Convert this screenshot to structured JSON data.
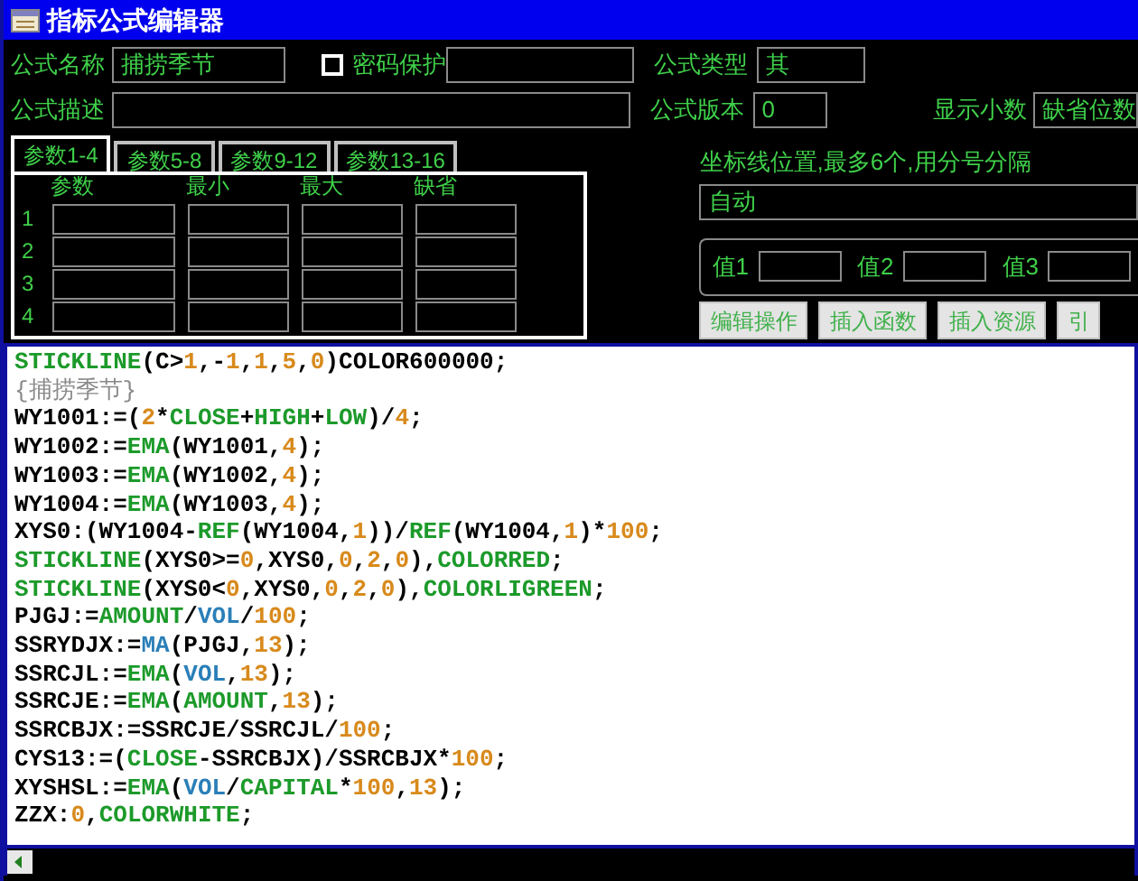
{
  "window": {
    "title": "指标公式编辑器"
  },
  "form": {
    "name_label": "公式名称",
    "name_value": "捕捞季节",
    "password": {
      "label": "密码保护",
      "checked": false
    },
    "type_label": "公式类型",
    "type_value": "其",
    "desc_label": "公式描述",
    "version_label": "公式版本",
    "version_value": "0",
    "decimals_label": "显示小数",
    "decimals_value": "缺省位数"
  },
  "tabs": [
    {
      "label": "参数1-4",
      "selected": true
    },
    {
      "label": "参数5-8",
      "selected": false
    },
    {
      "label": "参数9-12",
      "selected": false
    },
    {
      "label": "参数13-16",
      "selected": false
    }
  ],
  "params": {
    "columns": [
      "参数",
      "最小",
      "最大",
      "缺省"
    ],
    "rows": [
      "1",
      "2",
      "3",
      "4"
    ]
  },
  "axis": {
    "label": "坐标线位置,最多6个,用分号分隔",
    "value": "自动"
  },
  "values": [
    "值1",
    "值2",
    "值3"
  ],
  "buttons": [
    "编辑操作",
    "插入函数",
    "插入资源",
    "引"
  ],
  "code": [
    [
      {
        "kind": "kw",
        "text": "STICKLINE"
      },
      {
        "kind": "plain",
        "text": "(C>"
      },
      {
        "kind": "num",
        "text": "1"
      },
      {
        "kind": "plain",
        "text": ",-"
      },
      {
        "kind": "num",
        "text": "1"
      },
      {
        "kind": "plain",
        "text": ","
      },
      {
        "kind": "num",
        "text": "1"
      },
      {
        "kind": "plain",
        "text": ","
      },
      {
        "kind": "num",
        "text": "5"
      },
      {
        "kind": "plain",
        "text": ","
      },
      {
        "kind": "num",
        "text": "0"
      },
      {
        "kind": "plain",
        "text": ")COLOR600000;"
      }
    ],
    [
      {
        "kind": "comment",
        "text": "{捕捞季节}"
      }
    ],
    [
      {
        "kind": "plain",
        "text": "WY1001:=("
      },
      {
        "kind": "num",
        "text": "2"
      },
      {
        "kind": "plain",
        "text": "*"
      },
      {
        "kind": "kw",
        "text": "CLOSE"
      },
      {
        "kind": "plain",
        "text": "+"
      },
      {
        "kind": "kw",
        "text": "HIGH"
      },
      {
        "kind": "plain",
        "text": "+"
      },
      {
        "kind": "kw",
        "text": "LOW"
      },
      {
        "kind": "plain",
        "text": ")/"
      },
      {
        "kind": "num",
        "text": "4"
      },
      {
        "kind": "plain",
        "text": ";"
      }
    ],
    [
      {
        "kind": "plain",
        "text": "WY1002:="
      },
      {
        "kind": "kw",
        "text": "EMA"
      },
      {
        "kind": "plain",
        "text": "(WY1001,"
      },
      {
        "kind": "num",
        "text": "4"
      },
      {
        "kind": "plain",
        "text": ");"
      }
    ],
    [
      {
        "kind": "plain",
        "text": "WY1003:="
      },
      {
        "kind": "kw",
        "text": "EMA"
      },
      {
        "kind": "plain",
        "text": "(WY1002,"
      },
      {
        "kind": "num",
        "text": "4"
      },
      {
        "kind": "plain",
        "text": ");"
      }
    ],
    [
      {
        "kind": "plain",
        "text": "WY1004:="
      },
      {
        "kind": "kw",
        "text": "EMA"
      },
      {
        "kind": "plain",
        "text": "(WY1003,"
      },
      {
        "kind": "num",
        "text": "4"
      },
      {
        "kind": "plain",
        "text": ");"
      }
    ],
    [
      {
        "kind": "plain",
        "text": "XYS0:(WY1004-"
      },
      {
        "kind": "kw",
        "text": "REF"
      },
      {
        "kind": "plain",
        "text": "(WY1004,"
      },
      {
        "kind": "num",
        "text": "1"
      },
      {
        "kind": "plain",
        "text": "))/"
      },
      {
        "kind": "kw",
        "text": "REF"
      },
      {
        "kind": "plain",
        "text": "(WY1004,"
      },
      {
        "kind": "num",
        "text": "1"
      },
      {
        "kind": "plain",
        "text": ")*"
      },
      {
        "kind": "num",
        "text": "100"
      },
      {
        "kind": "plain",
        "text": ";"
      }
    ],
    [
      {
        "kind": "kw",
        "text": "STICKLINE"
      },
      {
        "kind": "plain",
        "text": "(XYS0>="
      },
      {
        "kind": "num",
        "text": "0"
      },
      {
        "kind": "plain",
        "text": ",XYS0,"
      },
      {
        "kind": "num",
        "text": "0"
      },
      {
        "kind": "plain",
        "text": ","
      },
      {
        "kind": "num",
        "text": "2"
      },
      {
        "kind": "plain",
        "text": ","
      },
      {
        "kind": "num",
        "text": "0"
      },
      {
        "kind": "plain",
        "text": "),"
      },
      {
        "kind": "kw",
        "text": "COLORRED"
      },
      {
        "kind": "plain",
        "text": ";"
      }
    ],
    [
      {
        "kind": "kw",
        "text": "STICKLINE"
      },
      {
        "kind": "plain",
        "text": "(XYS0<"
      },
      {
        "kind": "num",
        "text": "0"
      },
      {
        "kind": "plain",
        "text": ",XYS0,"
      },
      {
        "kind": "num",
        "text": "0"
      },
      {
        "kind": "plain",
        "text": ","
      },
      {
        "kind": "num",
        "text": "2"
      },
      {
        "kind": "plain",
        "text": ","
      },
      {
        "kind": "num",
        "text": "0"
      },
      {
        "kind": "plain",
        "text": "),"
      },
      {
        "kind": "kw",
        "text": "COLORLIGREEN"
      },
      {
        "kind": "plain",
        "text": ";"
      }
    ],
    [
      {
        "kind": "plain",
        "text": "PJGJ:="
      },
      {
        "kind": "kw",
        "text": "AMOUNT"
      },
      {
        "kind": "plain",
        "text": "/"
      },
      {
        "kind": "fn",
        "text": "VOL"
      },
      {
        "kind": "plain",
        "text": "/"
      },
      {
        "kind": "num",
        "text": "100"
      },
      {
        "kind": "plain",
        "text": ";"
      }
    ],
    [
      {
        "kind": "plain",
        "text": "SSRYDJX:="
      },
      {
        "kind": "fn",
        "text": "MA"
      },
      {
        "kind": "plain",
        "text": "(PJGJ,"
      },
      {
        "kind": "num",
        "text": "13"
      },
      {
        "kind": "plain",
        "text": ");"
      }
    ],
    [
      {
        "kind": "plain",
        "text": "SSRCJL:="
      },
      {
        "kind": "kw",
        "text": "EMA"
      },
      {
        "kind": "plain",
        "text": "("
      },
      {
        "kind": "fn",
        "text": "VOL"
      },
      {
        "kind": "plain",
        "text": ","
      },
      {
        "kind": "num",
        "text": "13"
      },
      {
        "kind": "plain",
        "text": ");"
      }
    ],
    [
      {
        "kind": "plain",
        "text": "SSRCJE:="
      },
      {
        "kind": "kw",
        "text": "EMA"
      },
      {
        "kind": "plain",
        "text": "("
      },
      {
        "kind": "kw",
        "text": "AMOUNT"
      },
      {
        "kind": "plain",
        "text": ","
      },
      {
        "kind": "num",
        "text": "13"
      },
      {
        "kind": "plain",
        "text": ");"
      }
    ],
    [
      {
        "kind": "plain",
        "text": "SSRCBJX:=SSRCJE/SSRCJL/"
      },
      {
        "kind": "num",
        "text": "100"
      },
      {
        "kind": "plain",
        "text": ";"
      }
    ],
    [
      {
        "kind": "plain",
        "text": "CYS13:=("
      },
      {
        "kind": "kw",
        "text": "CLOSE"
      },
      {
        "kind": "plain",
        "text": "-SSRCBJX)/SSRCBJX*"
      },
      {
        "kind": "num",
        "text": "100"
      },
      {
        "kind": "plain",
        "text": ";"
      }
    ],
    [
      {
        "kind": "plain",
        "text": "XYSHSL:="
      },
      {
        "kind": "kw",
        "text": "EMA"
      },
      {
        "kind": "plain",
        "text": "("
      },
      {
        "kind": "fn",
        "text": "VOL"
      },
      {
        "kind": "plain",
        "text": "/"
      },
      {
        "kind": "kw",
        "text": "CAPITAL"
      },
      {
        "kind": "plain",
        "text": "*"
      },
      {
        "kind": "num",
        "text": "100"
      },
      {
        "kind": "plain",
        "text": ","
      },
      {
        "kind": "num",
        "text": "13"
      },
      {
        "kind": "plain",
        "text": ");"
      }
    ],
    [
      {
        "kind": "plain",
        "text": "ZZX:"
      },
      {
        "kind": "num",
        "text": "0"
      },
      {
        "kind": "plain",
        "text": ","
      },
      {
        "kind": "kw",
        "text": "COLORWHITE"
      },
      {
        "kind": "plain",
        "text": ";"
      }
    ]
  ]
}
